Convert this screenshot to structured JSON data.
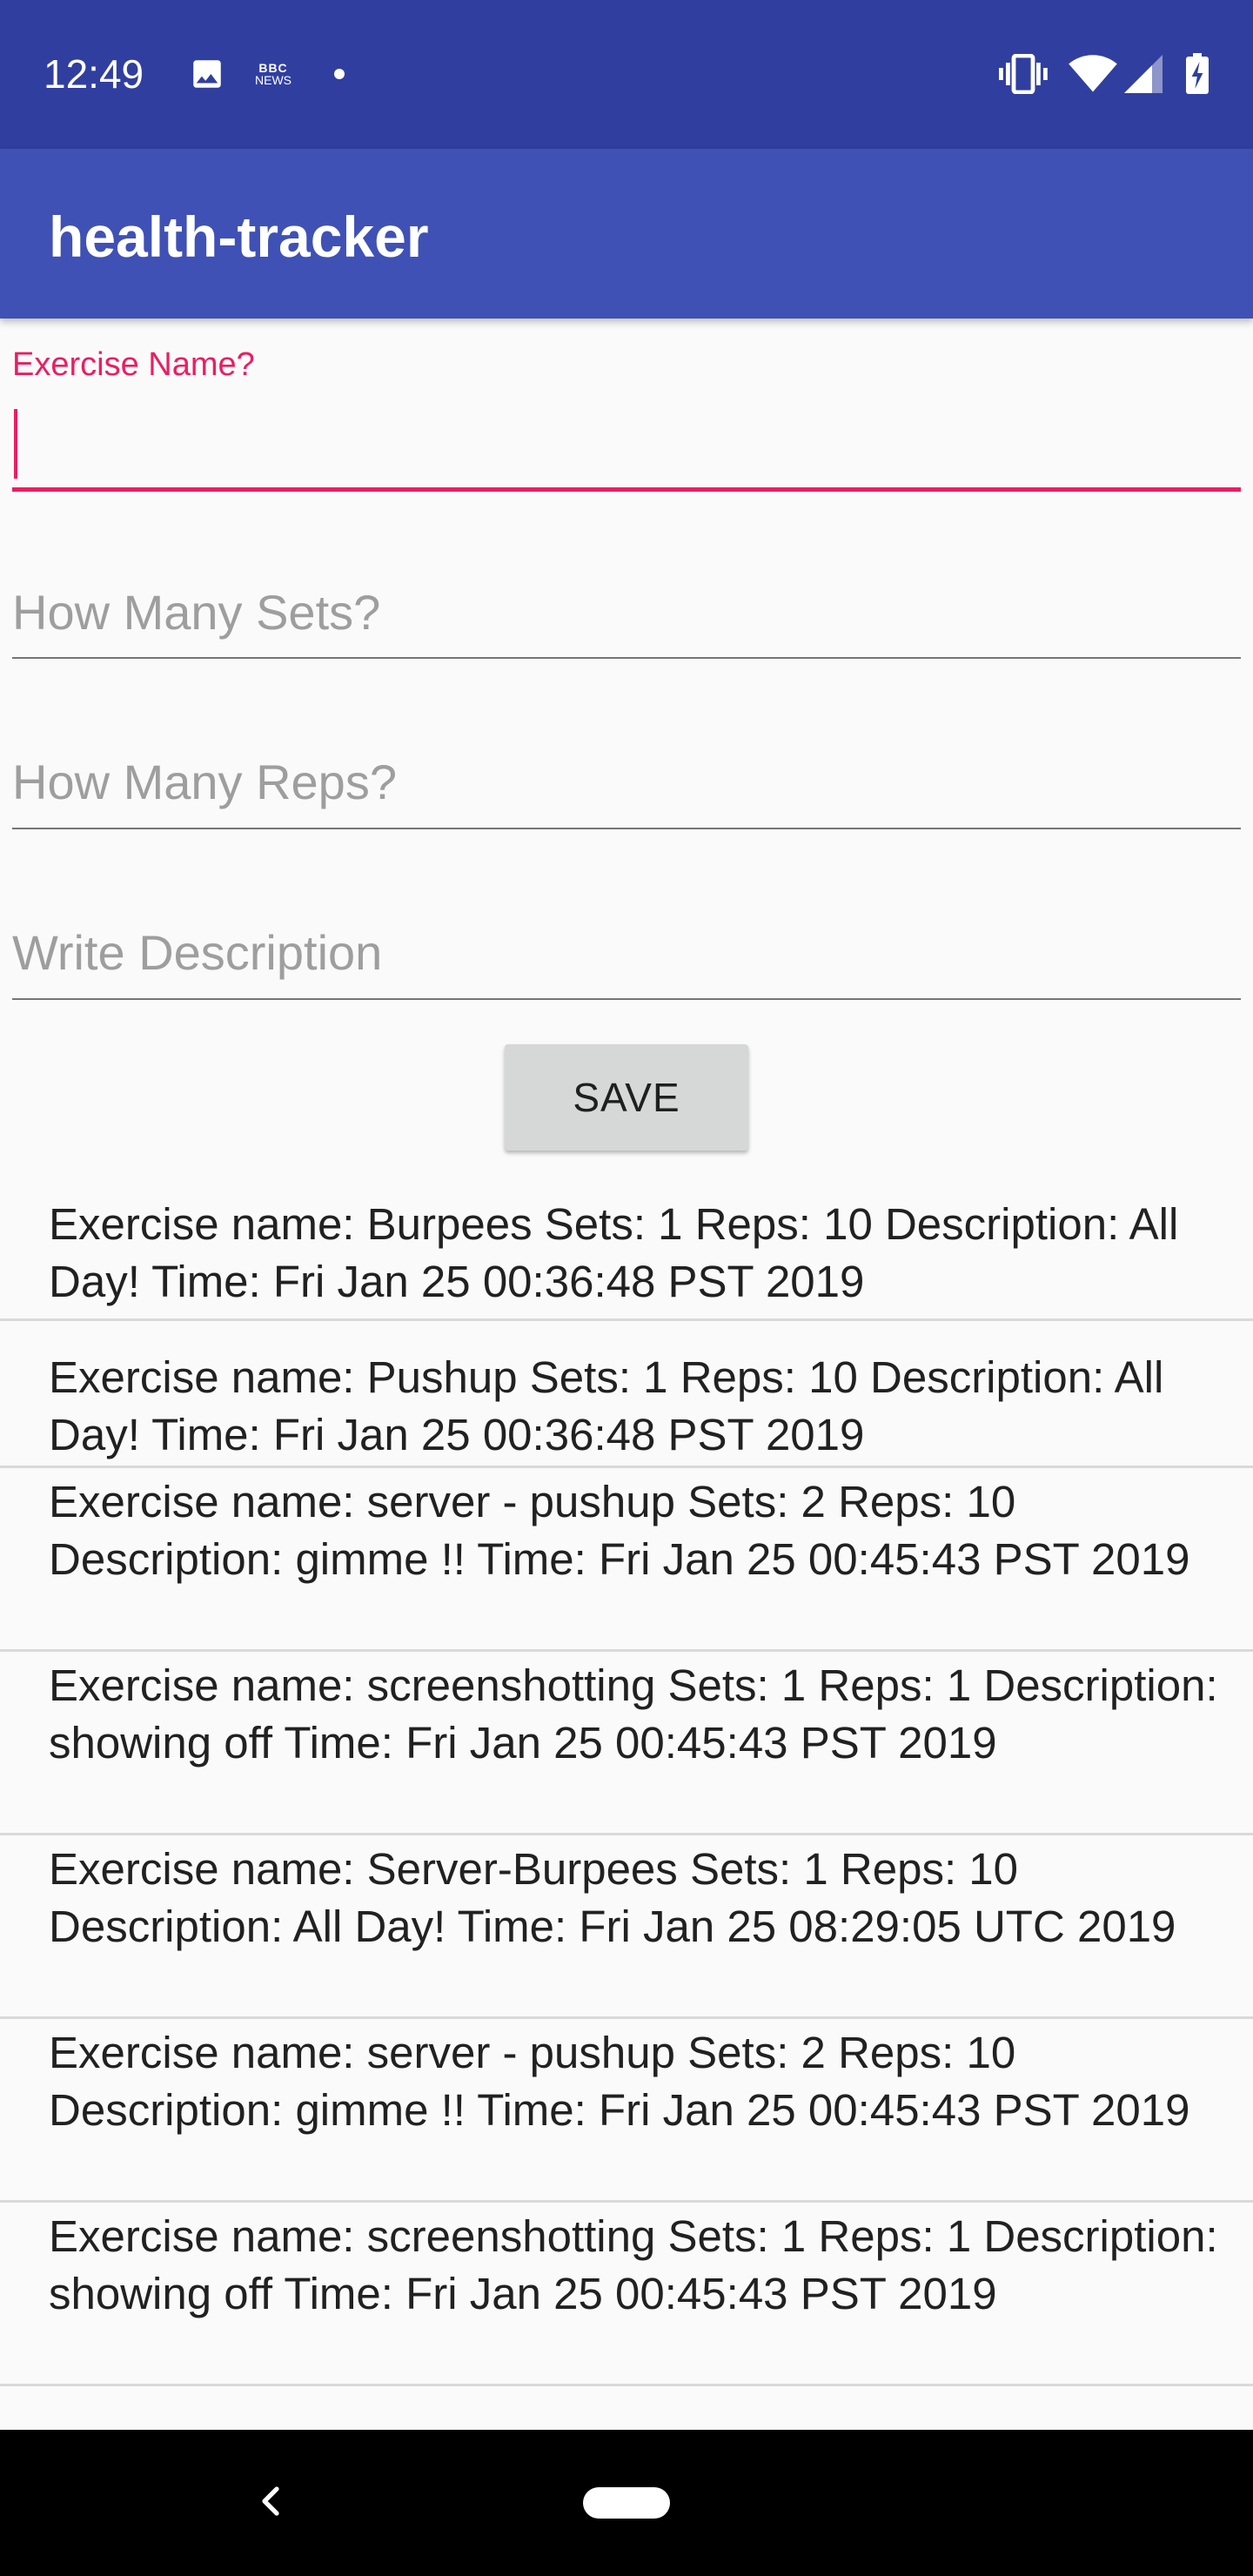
{
  "status_bar": {
    "time": "12:49",
    "left_icons": [
      "image-icon",
      "bbc-news-icon",
      "dot-icon"
    ],
    "right_icons": [
      "vibrate-icon",
      "wifi-icon",
      "cell-signal-icon",
      "battery-charging-icon"
    ],
    "bbc_line1": "BBC",
    "bbc_line2": "NEWS",
    "color": "#303f9f"
  },
  "app_bar": {
    "title": "health-tracker",
    "color": "#3f51b5"
  },
  "form": {
    "exercise_name": {
      "label": "Exercise Name?",
      "value": "",
      "focused": true
    },
    "sets": {
      "placeholder": "How Many Sets?",
      "value": ""
    },
    "reps": {
      "placeholder": "How Many Reps?",
      "value": ""
    },
    "description": {
      "placeholder": "Write Description",
      "value": ""
    },
    "save_label": "SAVE",
    "accent_color": "#e91e63"
  },
  "exercises": [
    {
      "text": "Exercise name: Burpees Sets: 1 Reps: 10 Description: All Day! Time: Fri Jan 25 00:36:48 PST 2019"
    },
    {
      "text": "Exercise name: Pushup Sets: 1 Reps: 10 Description: All Day! Time: Fri Jan 25 00:36:48 PST 2019"
    },
    {
      "text": "Exercise name: server - pushup Sets: 2 Reps: 10 Description: gimme !! Time: Fri Jan 25 00:45:43 PST 2019"
    },
    {
      "text": "Exercise name: screenshotting Sets: 1 Reps: 1 Description: showing off Time: Fri Jan 25 00:45:43 PST 2019"
    },
    {
      "text": "Exercise name: Server-Burpees Sets: 1 Reps: 10 Description: All Day! Time: Fri Jan 25 08:29:05 UTC 2019"
    },
    {
      "text": "Exercise name: server - pushup Sets: 2 Reps: 10 Description: gimme !! Time: Fri Jan 25 00:45:43 PST 2019"
    },
    {
      "text": "Exercise name: screenshotting Sets: 1 Reps: 1 Description: showing off Time: Fri Jan 25 00:45:43 PST 2019"
    }
  ],
  "nav_bar": {
    "icons": [
      "back-icon",
      "home-pill-icon"
    ]
  }
}
